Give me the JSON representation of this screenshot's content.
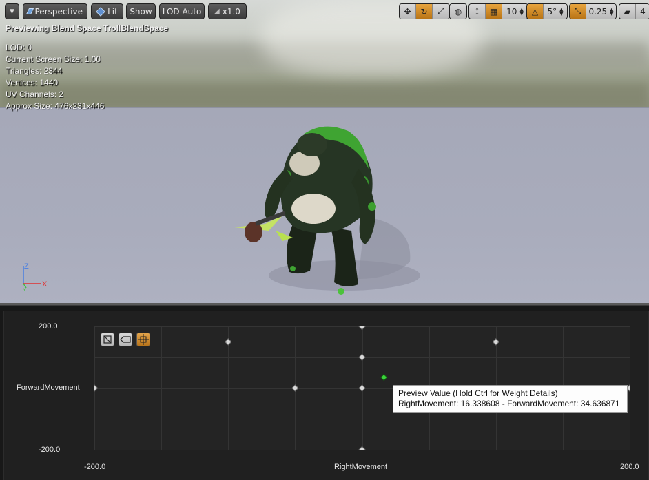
{
  "toolbar": {
    "perspective_label": "Perspective",
    "lit_label": "Lit",
    "show_label": "Show",
    "lod_label": "LOD Auto",
    "speed_label": "x1.0",
    "grid_snap_value": "10",
    "rotation_snap_value": "5°",
    "scale_snap_value": "0.25",
    "camera_speed_value": "4"
  },
  "overlay": {
    "preview_title": "Previewing Blend Space TrollBlendSpace",
    "lod": "LOD: 0",
    "screen_size": "Current Screen Size: 1.00",
    "triangles": "Triangles: 2344",
    "vertices": "Vertices: 1440",
    "uv_channels": "UV Channels: 2",
    "approx_size": "Approx Size: 476x231x446"
  },
  "gizmo": {
    "z": "Z",
    "x": "X",
    "y": "Y"
  },
  "blend_space": {
    "y_axis_label": "ForwardMovement",
    "y_max": "200.0",
    "y_min": "-200.0",
    "x_axis_label": "RightMovement",
    "x_min": "-200.0",
    "x_max": "200.0",
    "tooltip_title": "Preview Value (Hold Ctrl for Weight Details)",
    "tooltip_value": "RightMovement: 16.338608 - ForwardMovement: 34.636871",
    "samples": [
      {
        "x": 0,
        "y": 200
      },
      {
        "x": -100,
        "y": 150
      },
      {
        "x": 100,
        "y": 150
      },
      {
        "x": 0,
        "y": 100
      },
      {
        "x": -200,
        "y": 0
      },
      {
        "x": -50,
        "y": 0
      },
      {
        "x": 0,
        "y": 0
      },
      {
        "x": 200,
        "y": 0
      },
      {
        "x": 0,
        "y": -200
      }
    ],
    "preview_point": {
      "x": 16.338608,
      "y": 34.636871
    },
    "x_range": [
      -200,
      200
    ],
    "y_range": [
      -200,
      200
    ]
  },
  "colors": {
    "accent": "#e7a43e",
    "sample_point": "#d9d9d9",
    "preview_point": "#3bd13b",
    "gizmo_x": "#e03030",
    "gizmo_y": "#40c040",
    "gizmo_z": "#4a7fe0"
  }
}
